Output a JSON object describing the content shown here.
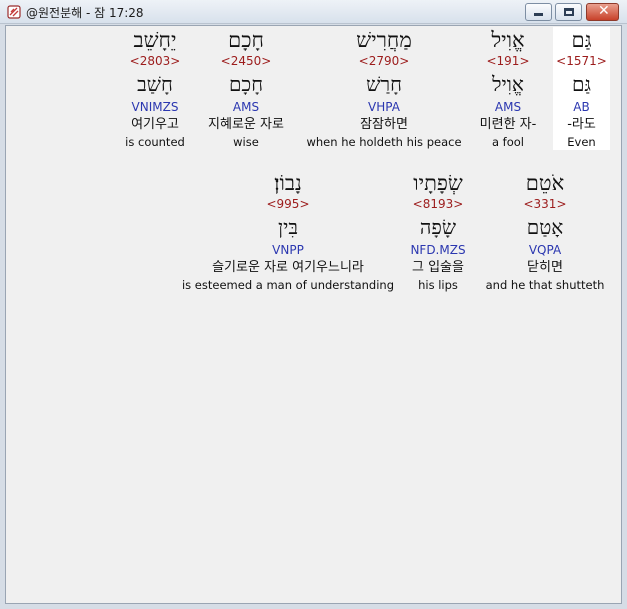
{
  "window": {
    "title": "@원전분해 - 잠 17:28",
    "icon": "scroll-app-icon"
  },
  "words": [
    {
      "hebrew": "גַּם",
      "strong": "<1571>",
      "lemma": "גַּם",
      "morph": "AB",
      "korean": "-라도",
      "english": "Even",
      "highlighted": true
    },
    {
      "hebrew": "אֱוִיל",
      "strong": "<191>",
      "lemma": "אֱוִיל",
      "morph": "AMS",
      "korean": "미련한 자-",
      "english": "a fool",
      "highlighted": false
    },
    {
      "hebrew": "מַחֲרִישׁ",
      "strong": "<2790>",
      "lemma": "חָרַשׁ",
      "morph": "VHPA",
      "korean": "잠잠하면",
      "english": "when he holdeth his peace",
      "highlighted": false
    },
    {
      "hebrew": "חָכָם",
      "strong": "<2450>",
      "lemma": "חָכָם",
      "morph": "AMS",
      "korean": "지혜로운 자로",
      "english": "wise",
      "highlighted": false
    },
    {
      "hebrew": "יֵחָשֵׁב",
      "strong": "<2803>",
      "lemma": "חָשַׁב",
      "morph": "VNIMZS",
      "korean": "여기우고",
      "english": "is counted",
      "highlighted": false
    },
    {
      "hebrew": "אֹטֵם",
      "strong": "<331>",
      "lemma": "אָטַם",
      "morph": "VQPA",
      "korean": "닫히면",
      "english": "and he that shutteth",
      "highlighted": false
    },
    {
      "hebrew": "שְׂפָתָיו",
      "strong": "<8193>",
      "lemma": "שָׂפָה",
      "morph": "NFD.MZS",
      "korean": "그 입술을",
      "english": "his lips",
      "highlighted": false
    },
    {
      "hebrew": "נָבוֹן׃",
      "strong": "<995>",
      "lemma": "בִּין",
      "morph": "VNPP",
      "korean": "슬기로운 자로 여기우느니라",
      "english": "is esteemed a man of understanding",
      "highlighted": false
    }
  ]
}
